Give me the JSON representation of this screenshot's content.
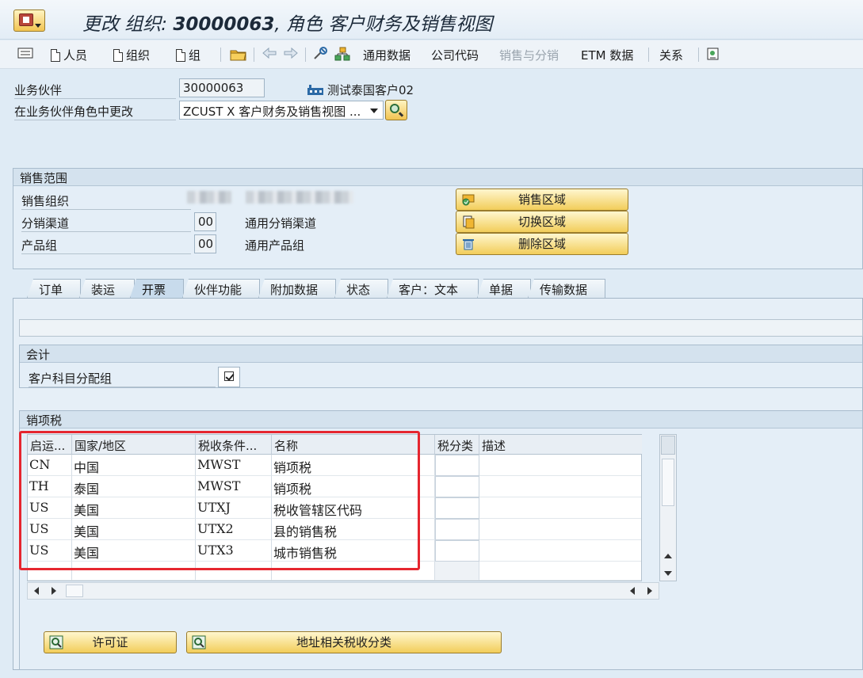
{
  "title": {
    "prefix": "更改 组织: ",
    "bp_number": "30000063",
    "suffix": ", 角色 客户财务及销售视图"
  },
  "toolbar": {
    "person": "人员",
    "org": "组织",
    "group": "组",
    "general_data": "通用数据",
    "company_code": "公司代码",
    "sales_distribution": "销售与分销",
    "etm_data": "ETM 数据",
    "relations": "关系"
  },
  "header": {
    "bp_label": "业务伙伴",
    "bp_value": "30000063",
    "bp_name": "测试泰国客户02",
    "role_label": "在业务伙伴角色中更改",
    "role_value": "ZCUST X 客户财务及销售视图 ..."
  },
  "sales_area": {
    "title": "销售范围",
    "sales_org_label": "销售组织",
    "dist_channel_label": "分销渠道",
    "dist_channel_value": "00",
    "dist_channel_desc": "通用分销渠道",
    "division_label": "产品组",
    "division_value": "00",
    "division_desc": "通用产品组",
    "btn_sales_area": "销售区域",
    "btn_switch_area": "切换区域",
    "btn_delete_area": "删除区域"
  },
  "tabs": [
    "订单",
    "装运",
    "开票",
    "伙伴功能",
    "附加数据",
    "状态",
    "客户：文本",
    "单据",
    "传输数据"
  ],
  "active_tab": "开票",
  "accounting": {
    "title": "会计",
    "acct_assign_label": "客户科目分配组",
    "acct_assign_checked": true
  },
  "output_tax": {
    "title": "销项税",
    "columns": [
      "启运...",
      "国家/地区",
      "税收条件...",
      "名称",
      "税分类",
      "描述"
    ],
    "rows": [
      {
        "dep": "CN",
        "country": "中国",
        "cond": "MWST",
        "name": "销项税",
        "class": "",
        "desc": ""
      },
      {
        "dep": "TH",
        "country": "泰国",
        "cond": "MWST",
        "name": "销项税",
        "class": "",
        "desc": ""
      },
      {
        "dep": "US",
        "country": "美国",
        "cond": "UTXJ",
        "name": "税收管辖区代码",
        "class": "",
        "desc": ""
      },
      {
        "dep": "US",
        "country": "美国",
        "cond": "UTX2",
        "name": "县的销售税",
        "class": "",
        "desc": ""
      },
      {
        "dep": "US",
        "country": "美国",
        "cond": "UTX3",
        "name": "城市销售税",
        "class": "",
        "desc": ""
      }
    ]
  },
  "bottom_buttons": {
    "license": "许可证",
    "address_tax": "地址相关税收分类"
  },
  "colors": {
    "highlight": "#e5262f",
    "button_gold": "#f2c451"
  }
}
